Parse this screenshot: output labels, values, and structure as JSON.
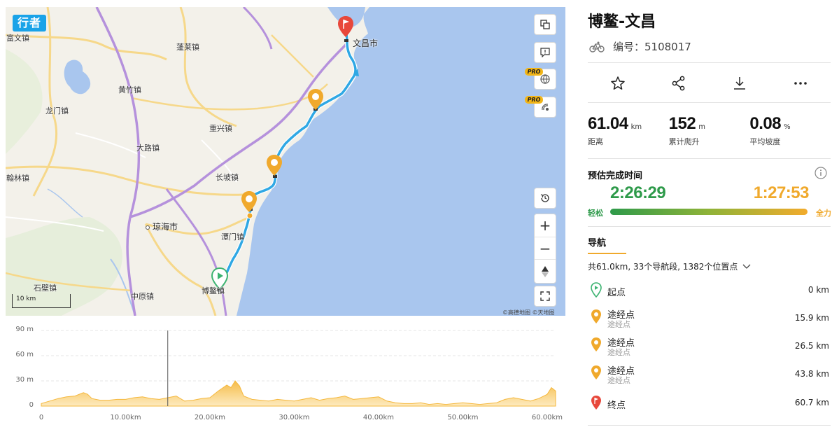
{
  "map": {
    "brand": "行者",
    "places": {
      "fuwen": "富文镇",
      "penglai": "蓬莱镇",
      "wenchang": "文昌市",
      "huangzhu": "黄竹镇",
      "longmen": "龙门镇",
      "chongxing": "重兴镇",
      "dalu": "大路镇",
      "hanlin": "翰林镇",
      "changpo": "长坡镇",
      "qionghai": "琼海市",
      "tanmen": "潭门镇",
      "shibi": "石壁镇",
      "zhongyuan": "中原镇",
      "boao": "博鳌镇"
    },
    "scale_label": "10 km",
    "attribution": "©高德地图 ©天地图",
    "pro_label": "PRO",
    "controls": {
      "copy": "copy-icon",
      "feedback": "feedback-icon",
      "globe": "globe-icon",
      "satellite": "satellite-icon",
      "reset": "history-icon",
      "zoom_in": "+",
      "zoom_out": "−",
      "compass": "compass-icon",
      "fullscreen": "fullscreen-icon"
    }
  },
  "chart_data": {
    "type": "area",
    "title": "",
    "xlabel": "",
    "ylabel": "",
    "y_ticks": [
      "90 m",
      "60 m",
      "30 m",
      "0"
    ],
    "x_ticks": [
      "0",
      "10.00km",
      "20.00km",
      "30.00km",
      "40.00km",
      "50.00km",
      "60.00km"
    ],
    "xlim": [
      0,
      61
    ],
    "ylim": [
      0,
      90
    ],
    "x": [
      0,
      1,
      2,
      3,
      4,
      5,
      5.5,
      6,
      7,
      8,
      9,
      10,
      11,
      12,
      13,
      14,
      15,
      16,
      17,
      18,
      19,
      20,
      21,
      22,
      22.5,
      23,
      23.5,
      24,
      25,
      26,
      27,
      28,
      29,
      30,
      31,
      32,
      33,
      34,
      35,
      36,
      37,
      38,
      39,
      40,
      41,
      42,
      43,
      44,
      45,
      46,
      47,
      48,
      49,
      50,
      51,
      52,
      53,
      54,
      55,
      56,
      57,
      58,
      59,
      60,
      60.5,
      61
    ],
    "elevation": [
      3,
      6,
      9,
      11,
      12,
      16,
      14,
      9,
      7,
      7,
      8,
      8,
      10,
      11,
      9,
      8,
      10,
      12,
      6,
      7,
      9,
      10,
      18,
      25,
      22,
      30,
      24,
      12,
      8,
      7,
      6,
      8,
      7,
      6,
      8,
      10,
      7,
      9,
      10,
      12,
      8,
      9,
      10,
      11,
      6,
      4,
      3,
      3,
      4,
      2,
      3,
      2,
      3,
      4,
      3,
      2,
      3,
      4,
      8,
      10,
      8,
      6,
      9,
      14,
      22,
      18
    ],
    "cursor_x": 15,
    "color": "#f5b83d"
  },
  "panel": {
    "title": "博鳌-文昌",
    "id_label": "编号：5108017",
    "actions": [
      "star-icon",
      "share-icon",
      "download-icon",
      "more-icon"
    ],
    "stats": [
      {
        "value": "61.04",
        "unit": "km",
        "label": "距离"
      },
      {
        "value": "152",
        "unit": "m",
        "label": "累计爬升"
      },
      {
        "value": "0.08",
        "unit": "%",
        "label": "平均坡度"
      }
    ],
    "eta": {
      "title": "预估完成时间",
      "easy_time": "2:26:29",
      "hard_time": "1:27:53",
      "easy_label": "轻松",
      "hard_label": "全力"
    },
    "nav": {
      "tab": "导航",
      "summary": "共61.0km, 33个导航段, 1382个位置点"
    },
    "waypoints": [
      {
        "name": "起点",
        "sub": "",
        "dist": "0 km",
        "type": "start",
        "color": "#3cb371"
      },
      {
        "name": "途经点",
        "sub": "途经点",
        "dist": "15.9 km",
        "type": "via",
        "color": "#f0a92c"
      },
      {
        "name": "途经点",
        "sub": "途经点",
        "dist": "26.5 km",
        "type": "via",
        "color": "#f0a92c"
      },
      {
        "name": "途经点",
        "sub": "途经点",
        "dist": "43.8 km",
        "type": "via",
        "color": "#f0a92c"
      },
      {
        "name": "终点",
        "sub": "",
        "dist": "60.7 km",
        "type": "end",
        "color": "#e8483b"
      }
    ]
  },
  "colors": {
    "route": "#2fa8e4",
    "sea": "#a9c6ee",
    "land": "#f3f1ea",
    "accent": "#f0a92c",
    "easy": "#2e9a4a"
  }
}
